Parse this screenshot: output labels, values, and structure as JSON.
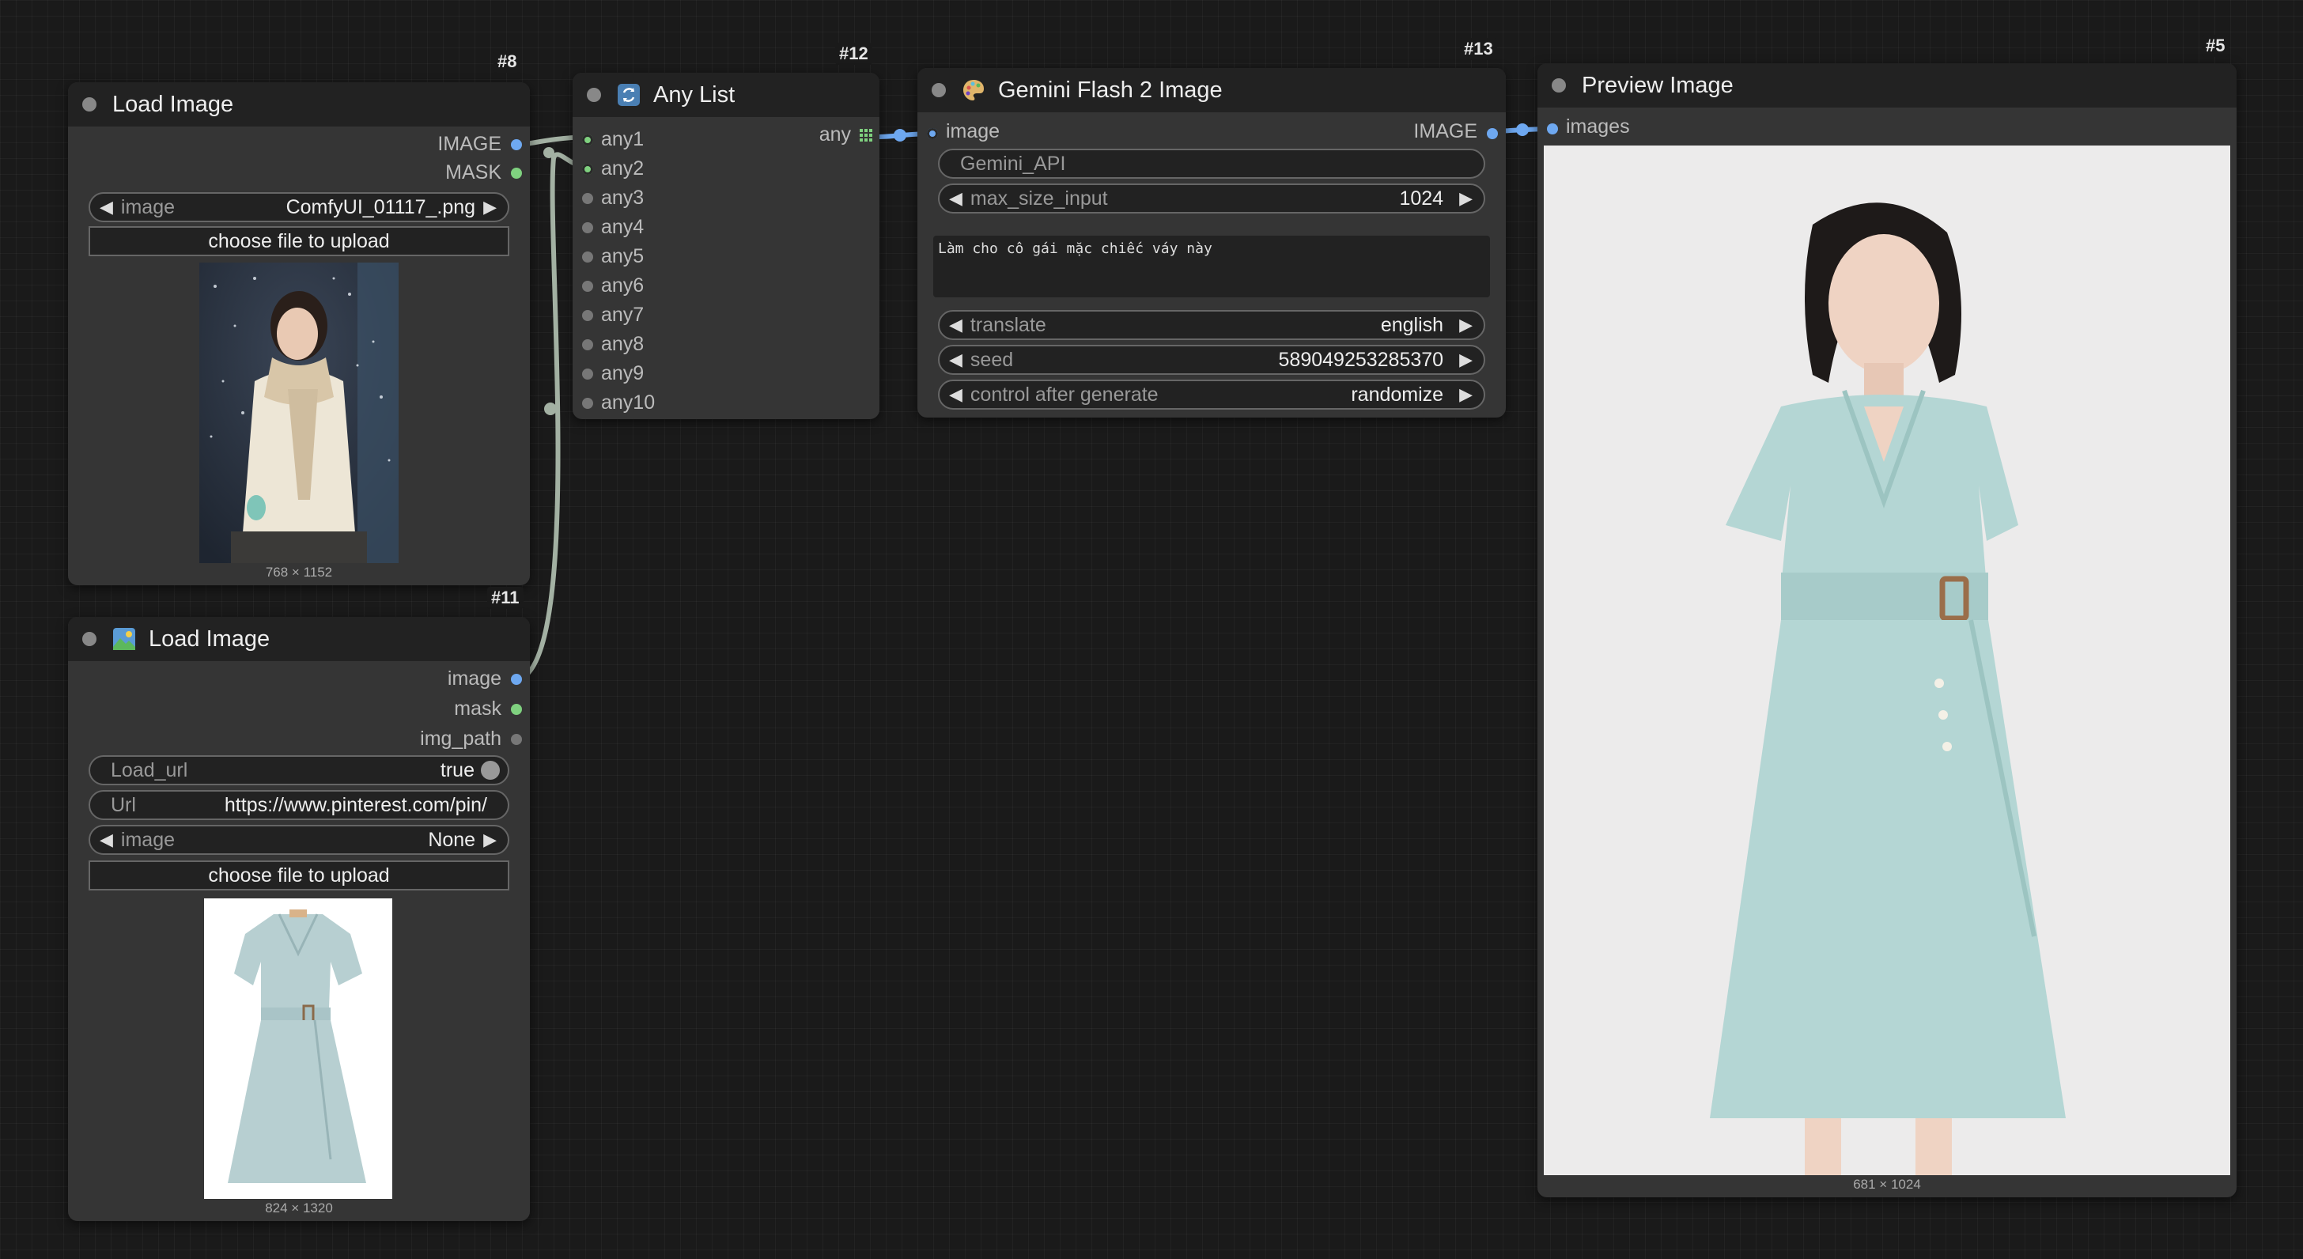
{
  "nodes": {
    "load_image_8": {
      "id": "#8",
      "title": "Load Image",
      "outputs": [
        "IMAGE",
        "MASK"
      ],
      "image_label": "image",
      "image_value": "ComfyUI_01117_.png",
      "upload_label": "choose file to upload",
      "dims": "768 × 1152"
    },
    "load_image_11": {
      "id": "#11",
      "title": "Load Image",
      "outputs": [
        "image",
        "mask",
        "img_path"
      ],
      "load_url_label": "Load_url",
      "load_url_value": "true",
      "url_label": "Url",
      "url_value": "https://www.pinterest.com/pin/",
      "image_label": "image",
      "image_value": "None",
      "upload_label": "choose file to upload",
      "dims": "824 × 1320"
    },
    "any_list_12": {
      "id": "#12",
      "title": "Any List",
      "inputs": [
        "any1",
        "any2",
        "any3",
        "any4",
        "any5",
        "any6",
        "any7",
        "any8",
        "any9",
        "any10"
      ],
      "output": "any"
    },
    "gemini_13": {
      "id": "#13",
      "title": "Gemini Flash 2 Image",
      "input": "image",
      "output": "IMAGE",
      "api_widget": "Gemini_API",
      "max_size_label": "max_size_input",
      "max_size_value": "1024",
      "prompt": "Làm cho cô gái mặc chiếc váy này",
      "translate_label": "translate",
      "translate_value": "english",
      "seed_label": "seed",
      "seed_value": "589049253285370",
      "control_label": "control after generate",
      "control_value": "randomize"
    },
    "preview_5": {
      "id": "#5",
      "title": "Preview Image",
      "input": "images",
      "dims": "681 × 1024"
    }
  },
  "colors": {
    "canvas": "#1a1a1a",
    "node_body": "#353535",
    "node_title": "#222222",
    "image_slot": "#6ea8f0",
    "mask_slot": "#7fd17f",
    "wire_gray": "#a3b1a3",
    "wire_blue": "#6ea8f0"
  },
  "icons": {
    "any_list": "refresh-icon",
    "gemini": "palette-icon",
    "load_image_11": "picture-icon"
  }
}
